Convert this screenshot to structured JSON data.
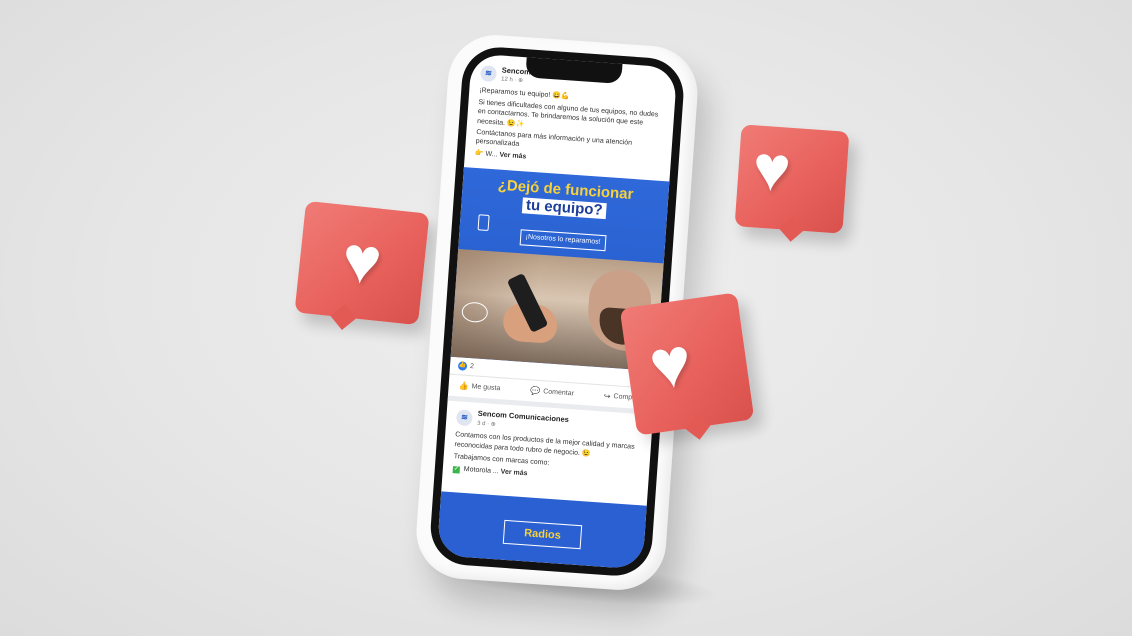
{
  "feed": {
    "post1": {
      "page_name": "Sencom Comunicaciones",
      "meta": "12 h · ⊕",
      "line1": "¡Reparamos tu equipo! 😄💪",
      "line2": "Si tienes dificultades con alguno de tus equipos, no dudes en contactarnos. Te brindaremos la solución que este necesita. 😉✨",
      "line3": "Contáctanos para más información y una atención personalizada",
      "line4": "👉 W...",
      "see_more": "Ver más",
      "banner": {
        "title_line1": "¿Dejó de funcionar",
        "title_line2": "tu equipo?",
        "badge": "¡Nosotros lo reparamos!"
      },
      "reaction_count": "2",
      "actions": {
        "like": "Me gusta",
        "comment": "Comentar",
        "share": "Compartir"
      }
    },
    "post2": {
      "page_name": "Sencom Comunicaciones",
      "meta": "3 d · ⊕",
      "line1": "Contamos con los productos de la mejor calidad y marcas reconocidas para todo rubro de negocio. 😉",
      "line2": "Trabajamos con marcas como:",
      "line3": "Motorola ...",
      "see_more": "Ver más",
      "banner_text": "Radios"
    }
  },
  "icons": {
    "heart": "heart-icon",
    "like": "thumbs-up-icon",
    "comment": "comment-icon",
    "share": "share-icon"
  },
  "colors": {
    "brand_blue": "#2a60d1",
    "title_yellow": "#f7d23a",
    "heart_red": "#e8605b",
    "like_blue": "#2d7cf4"
  }
}
